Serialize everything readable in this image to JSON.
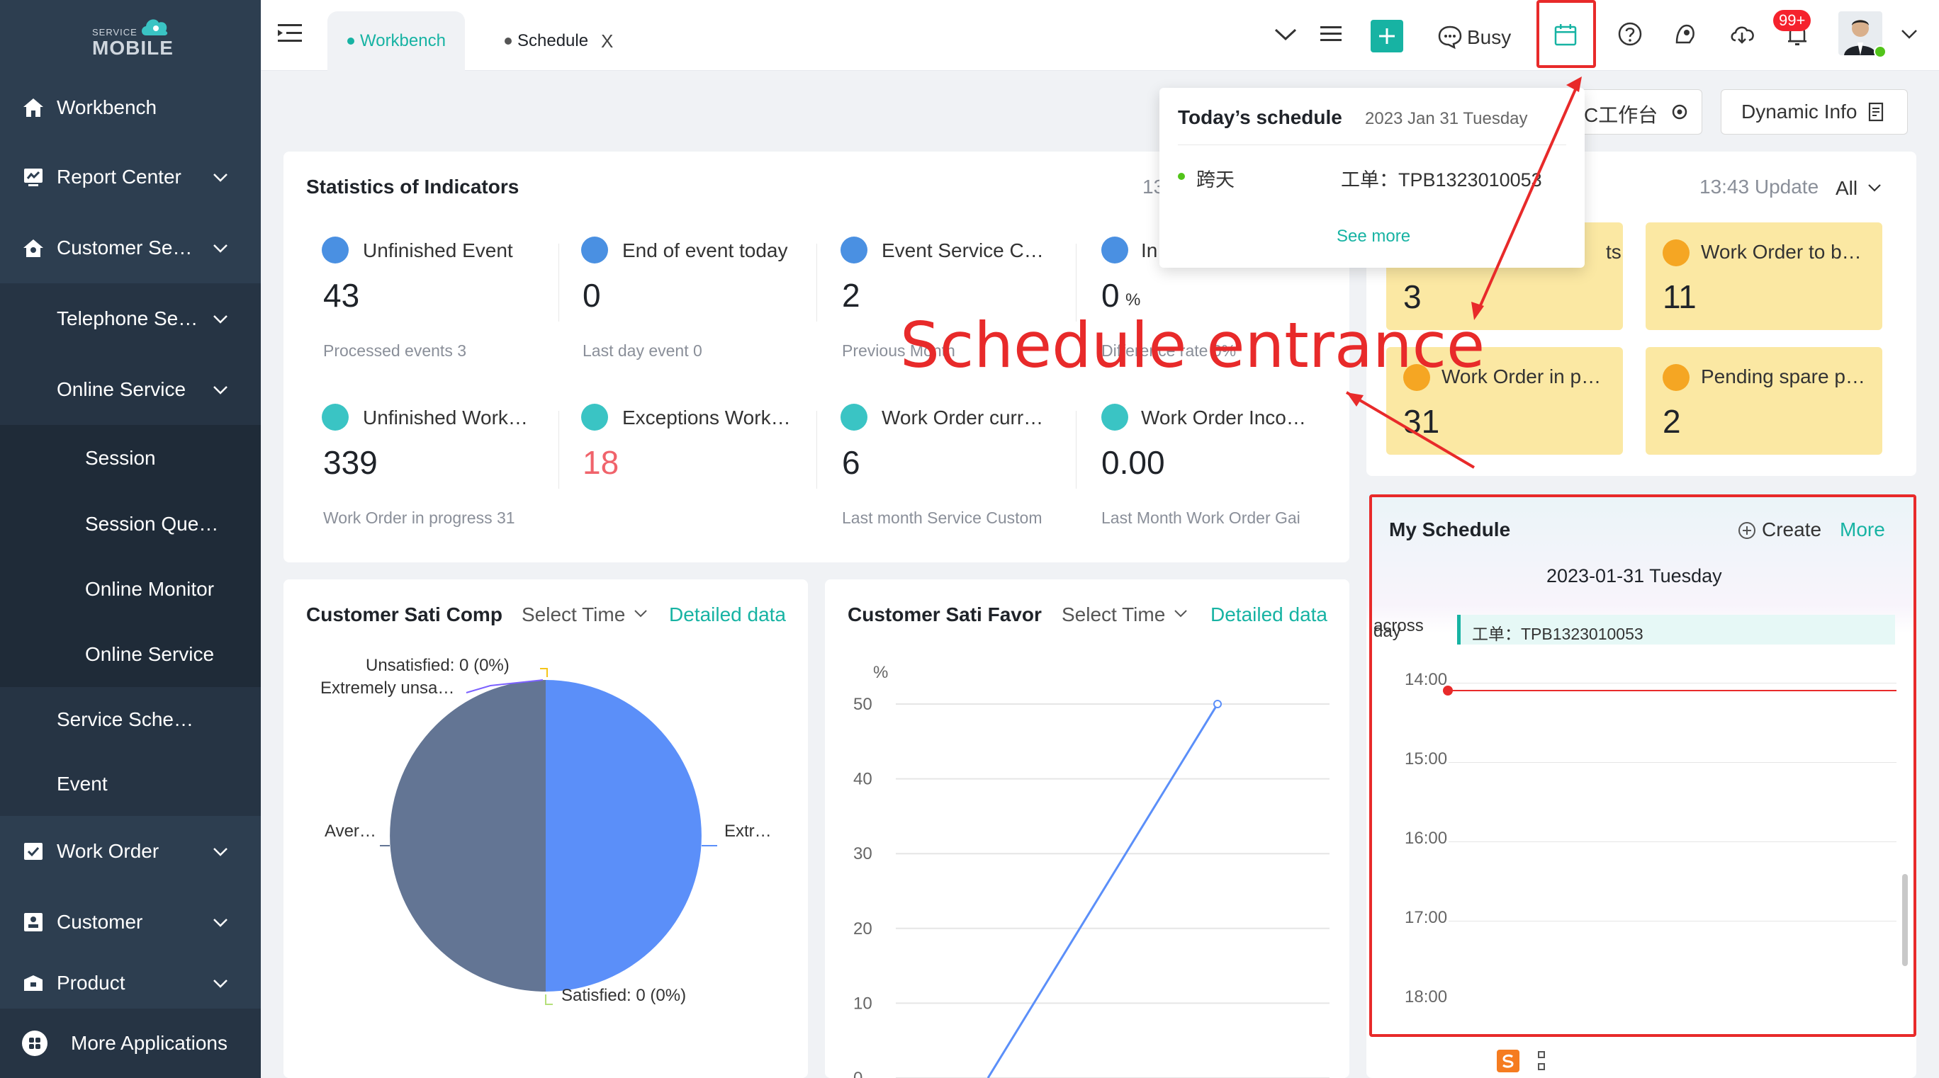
{
  "logo": {
    "top": "SERVICE",
    "main": "MOBILE"
  },
  "sidebar": {
    "items": [
      {
        "label": "Workbench",
        "icon": "home-icon"
      },
      {
        "label": "Report Center",
        "icon": "report-icon"
      },
      {
        "label": "Customer Se…",
        "icon": "customer-service-icon"
      },
      {
        "label": "Telephone Se…"
      },
      {
        "label": "Online Service"
      },
      {
        "label": "Session"
      },
      {
        "label": "Session Que…"
      },
      {
        "label": "Online Monitor"
      },
      {
        "label": "Online Service"
      },
      {
        "label": "Service Sche…"
      },
      {
        "label": "Event"
      },
      {
        "label": "Work Order",
        "icon": "work-order-icon"
      },
      {
        "label": "Customer",
        "icon": "customer-icon"
      },
      {
        "label": "Product",
        "icon": "product-icon"
      }
    ],
    "more_apps": "More Applications"
  },
  "topbar": {
    "tabs": [
      {
        "label": "Workbench"
      },
      {
        "label": "Schedule",
        "close": "X"
      }
    ],
    "status": "Busy",
    "notification_badge": "99+"
  },
  "popup": {
    "title": "Today’s schedule",
    "date": "2023 Jan 31 Tuesday",
    "item_tag": "跨天",
    "item_text": "工单：TPB1323010053",
    "see_more": "See more"
  },
  "buttons": {
    "workbench_cn": "C工作台",
    "dynamic_info": "Dynamic Info"
  },
  "annotation": {
    "label": "Schedule entrance",
    "color": "#e82a2a"
  },
  "stats": {
    "title": "Statistics of Indicators",
    "partial_time": "13",
    "kpis": [
      {
        "title": "Unfinished Event",
        "value": "43",
        "sub": "Processed events  3"
      },
      {
        "title": "End of event today",
        "value": "0",
        "sub": "Last day event  0"
      },
      {
        "title": "Event Service C…",
        "value": "2",
        "sub": "Previous Month"
      },
      {
        "title": "In",
        "value": "0",
        "unit": "%",
        "sub": "Difference rate  0%"
      },
      {
        "title": "Unfinished Work…",
        "value": "339",
        "sub": "Work Order in progress  31"
      },
      {
        "title": "Exceptions Work…",
        "value": "18",
        "sub": ""
      },
      {
        "title": "Work Order curr…",
        "value": "6",
        "sub": "Last month Service Custom"
      },
      {
        "title": "Work Order Inco…",
        "value": "0.00",
        "sub": "Last Month Work Order Gai"
      }
    ]
  },
  "right_panel": {
    "update": "13:43 Update",
    "filter": "All",
    "cards": [
      {
        "title": "ts",
        "value": "3"
      },
      {
        "title": "Work Order to b…",
        "value": "11"
      },
      {
        "title": "Work Order in p…",
        "value": "31"
      },
      {
        "title": "Pending spare p…",
        "value": "2"
      }
    ]
  },
  "schedule": {
    "title": "My Schedule",
    "create": "Create",
    "more": "More",
    "date": "2023-01-31 Tuesday",
    "allday_label": "across",
    "allday_label2": "day",
    "allday_event": "工单：TPB1323010053",
    "hours": [
      "14:00",
      "15:00",
      "16:00",
      "17:00",
      "18:00"
    ]
  },
  "pie_card": {
    "title": "Customer Sati Comp",
    "select": "Select Time",
    "link": "Detailed data",
    "labels": {
      "unsatisfied": "Unsatisfied:  0 (0%)",
      "extremely_unsat": "Extremely unsa…",
      "average": "Aver…",
      "extremely": "Extr…",
      "satisfied": "Satisfied:  0 (0%)"
    },
    "colors": {
      "left": "#637594",
      "right": "#5b8ff9"
    }
  },
  "line_card": {
    "title": "Customer Sati Favor",
    "select": "Select Time",
    "link": "Detailed data"
  },
  "chart_data": {
    "type": "line",
    "ylabel": "%",
    "ylim": [
      0,
      50
    ],
    "yticks": [
      "50",
      "40",
      "30",
      "20",
      "10",
      "0"
    ],
    "series": [
      {
        "values": [
          0,
          50
        ]
      }
    ]
  },
  "colors": {
    "accent": "#17b3a3",
    "sidebar": "#2d3e50",
    "red": "#e82a2a"
  }
}
